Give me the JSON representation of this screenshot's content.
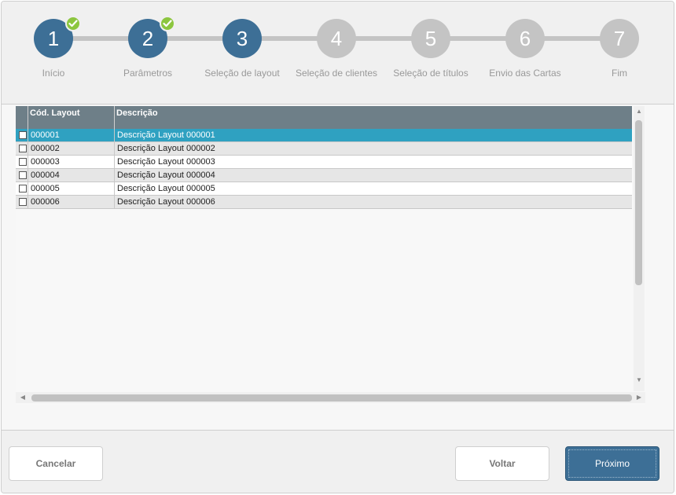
{
  "stepper": {
    "steps": [
      {
        "number": "1",
        "label": "Início",
        "state": "done"
      },
      {
        "number": "2",
        "label": "Parâmetros",
        "state": "done"
      },
      {
        "number": "3",
        "label": "Seleção de layout",
        "state": "current"
      },
      {
        "number": "4",
        "label": "Seleção de clientes",
        "state": "pending"
      },
      {
        "number": "5",
        "label": "Seleção de títulos",
        "state": "pending"
      },
      {
        "number": "6",
        "label": "Envio das Cartas",
        "state": "pending"
      },
      {
        "number": "7",
        "label": "Fim",
        "state": "pending"
      }
    ]
  },
  "grid": {
    "columns": [
      "Cód. Layout",
      "Descrição"
    ],
    "rows": [
      {
        "code": "000001",
        "description": "Descrição Layout 000001",
        "selected": true
      },
      {
        "code": "000002",
        "description": "Descrição Layout 000002",
        "selected": false
      },
      {
        "code": "000003",
        "description": "Descrição Layout 000003",
        "selected": false
      },
      {
        "code": "000004",
        "description": "Descrição Layout 000004",
        "selected": false
      },
      {
        "code": "000005",
        "description": "Descrição Layout 000005",
        "selected": false
      },
      {
        "code": "000006",
        "description": "Descrição Layout 000006",
        "selected": false
      }
    ]
  },
  "footer": {
    "cancel_label": "Cancelar",
    "back_label": "Voltar",
    "next_label": "Próximo"
  },
  "colors": {
    "done_step": "#3d6f96",
    "pending_step": "#c4c4c4",
    "check_badge": "#8cc63f",
    "selected_row": "#2fa1c1",
    "grid_header": "#6e7f88"
  }
}
